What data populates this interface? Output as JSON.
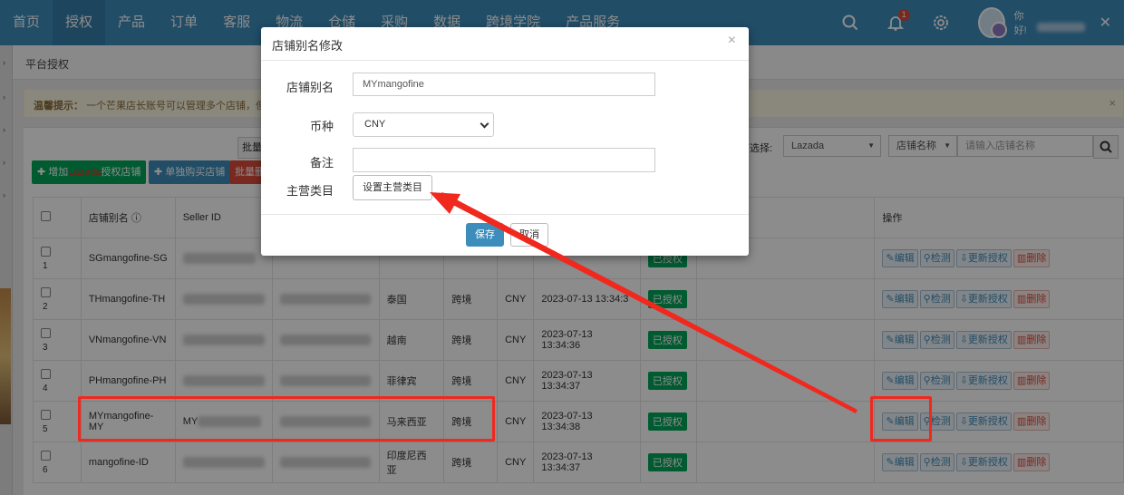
{
  "nav": {
    "items": [
      "首页",
      "授权",
      "产品",
      "订单",
      "客服",
      "物流",
      "仓储",
      "采购",
      "数据",
      "跨境学院",
      "产品服务"
    ],
    "active_index": 1,
    "notification_count": "1",
    "user_greeting": "你好!"
  },
  "breadcrumb": "平台授权",
  "warning": {
    "label": "温馨提示：",
    "text": "一个芒果店长账号可以管理多个店铺，但"
  },
  "toolbar": {
    "add_prefix": "增加",
    "add_platform": "Lazada",
    "add_suffix": "授权店铺",
    "buy_label": "单独购买店铺",
    "batch_delete_label": "批量删",
    "batch_label": "批量",
    "select_label": "店选择:",
    "platform_select": "Lazada",
    "field_select": "店铺名称",
    "search_placeholder": "请输入店铺名称"
  },
  "table": {
    "headers": {
      "alias": "店铺别名",
      "seller_id": "Seller ID",
      "ops": "操作"
    },
    "rows": [
      {
        "idx": "1",
        "alias": "SGmangofine-SG",
        "seller": "",
        "country": "",
        "type": "",
        "currency": "",
        "time": "",
        "status": "已授权"
      },
      {
        "idx": "2",
        "alias": "THmangofine-TH",
        "seller": "",
        "country": "泰国",
        "type": "跨境",
        "currency": "CNY",
        "time": "2023-07-13 13:34:3",
        "status": "已授权"
      },
      {
        "idx": "3",
        "alias": "VNmangofine-VN",
        "seller": "",
        "country": "越南",
        "type": "跨境",
        "currency": "CNY",
        "time": "2023-07-13 13:34:36",
        "status": "已授权"
      },
      {
        "idx": "4",
        "alias": "PHmangofine-PH",
        "seller": "",
        "country": "菲律宾",
        "type": "跨境",
        "currency": "CNY",
        "time": "2023-07-13 13:34:37",
        "status": "已授权"
      },
      {
        "idx": "5",
        "alias": "MYmangofine-MY",
        "seller": "MY",
        "country": "马来西亚",
        "type": "跨境",
        "currency": "CNY",
        "time": "2023-07-13 13:34:38",
        "status": "已授权"
      },
      {
        "idx": "6",
        "alias": "mangofine-ID",
        "seller": "",
        "country": "印度尼西亚",
        "type": "跨境",
        "currency": "CNY",
        "time": "2023-07-13 13:34:37",
        "status": "已授权"
      }
    ],
    "op_labels": {
      "edit": "编辑",
      "check": "检测",
      "update": "更新授权",
      "delete": "删除"
    }
  },
  "modal": {
    "title": "店铺别名修改",
    "alias_label": "店铺别名",
    "alias_value": "MYmangofine",
    "currency_label": "币种",
    "currency_value": "CNY",
    "remark_label": "备注",
    "category_label": "主营类目",
    "category_button": "设置主营类目",
    "save": "保存",
    "cancel": "取消"
  },
  "colors": {
    "nav": "#3c8dbc",
    "highlight": "#f0281e",
    "authorized": "#00a65a"
  }
}
